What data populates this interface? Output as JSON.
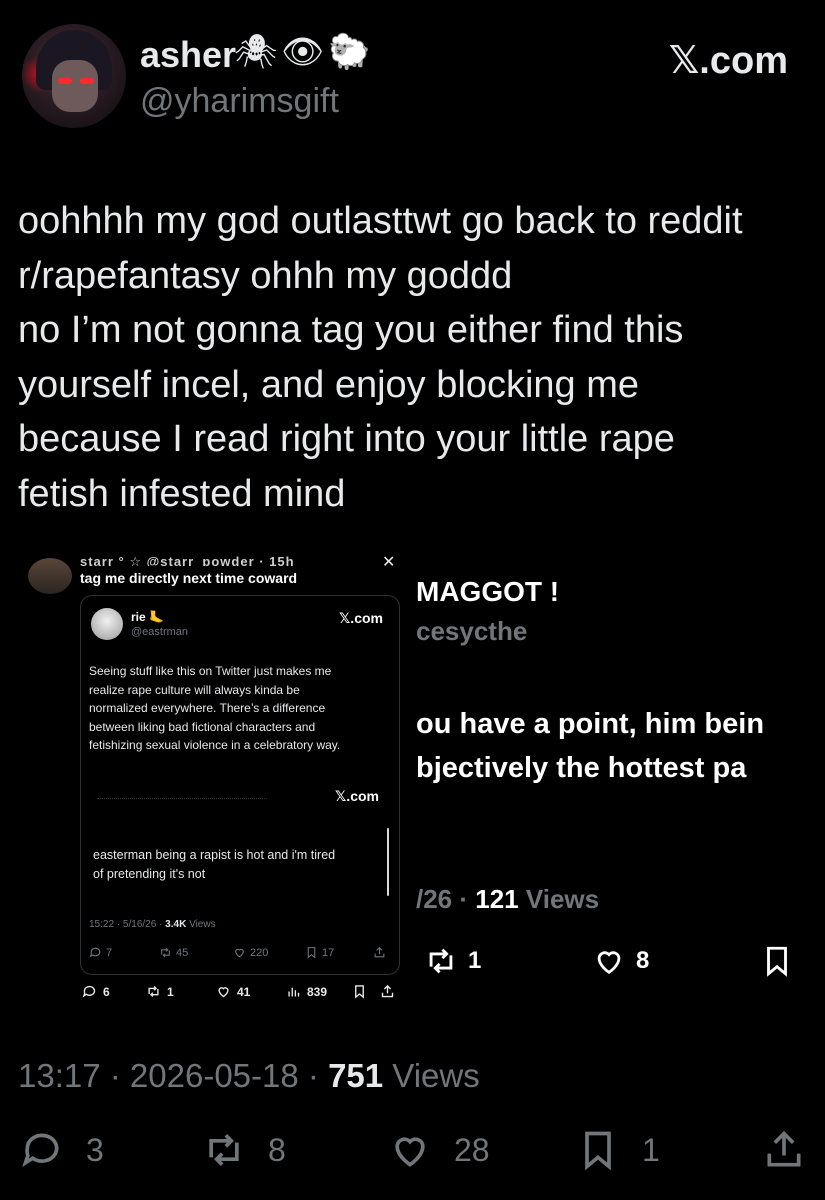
{
  "header": {
    "display_name": "asher",
    "name_emojis": "🕷👁🐑",
    "handle": "@yharimsgift",
    "site": "𝕏.com"
  },
  "tweet": {
    "lines": [
      "oohhhh my god outlasttwt go back to reddit",
      "r/rapefantasy ohhh my goddd",
      "no I’m not gonna tag you either find this",
      "yourself incel, and enjoy blocking me",
      "because I read right into your little rape",
      "fetish infested mind"
    ],
    "time": "13:17",
    "date": "2026-05-18",
    "views_count": "751",
    "views_label": "Views",
    "replies": "3",
    "reposts": "8",
    "likes": "28",
    "bookmarks": "1"
  },
  "embedded": {
    "header_partial": "starr ° ☆ @starr_powder · 15h",
    "close_icon": "close-icon",
    "text": "tag me directly next time coward",
    "inner": {
      "name": "rie 🦶",
      "handle": "@eastrman",
      "site": "𝕏.com",
      "text_lines": [
        "Seeing stuff like this on Twitter just makes me",
        "realize rape culture will always kinda be",
        "normalized everywhere. There’s a difference",
        "between liking bad fictional characters and",
        "fetishizing sexual violence in a celebratory way."
      ],
      "site2": "𝕏.com",
      "quote_lines": [
        "easterman being a rapist is hot and i'm tired",
        "of pretending it's not"
      ],
      "meta_time": "15:22 · 5/16/26 · ",
      "meta_views_count": "3.4K",
      "meta_views_label": "Views",
      "replies": "7",
      "reposts": "45",
      "likes": "220",
      "bookmarks": "17"
    },
    "replies": "6",
    "reposts": "1",
    "likes": "41",
    "views": "839"
  },
  "right_crop": {
    "name": "MAGGOT !",
    "handle": "cesycthe",
    "line1": "ou have a point, him bein",
    "line2": "bjectively the hottest pa",
    "meta_prefix": "/26 · ",
    "views_count": "121",
    "views_label": "Views",
    "reposts": "1",
    "likes": "8"
  },
  "colors": {
    "background": "#000000",
    "text": "#e7e9ea",
    "muted": "#71767b"
  }
}
